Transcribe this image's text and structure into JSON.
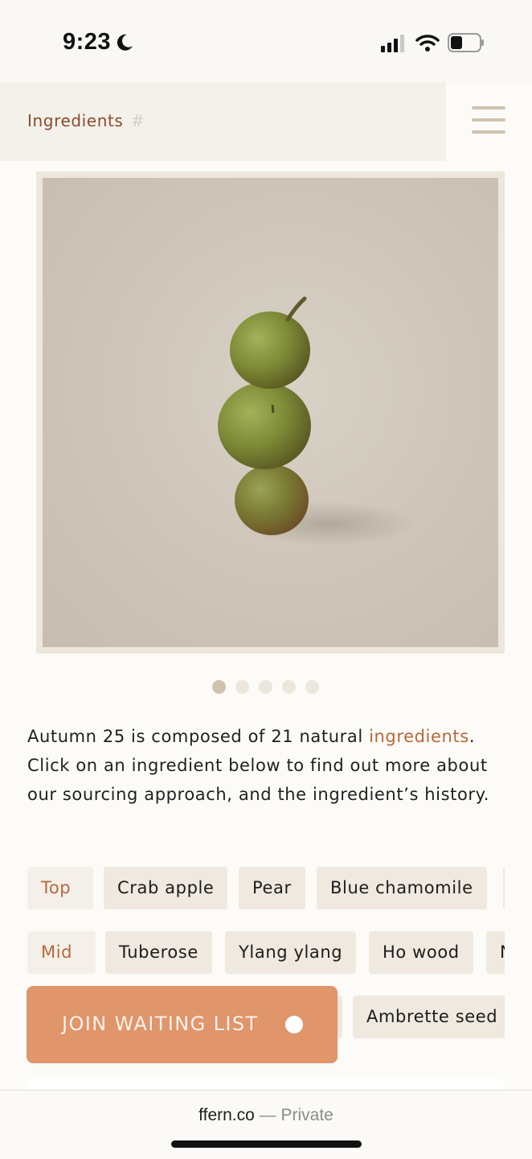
{
  "status_bar": {
    "time": "9:23",
    "icons": [
      "moon-icon",
      "signal-icon",
      "wifi-icon",
      "battery-icon"
    ]
  },
  "header": {
    "title": "Ingredients",
    "hash": "#",
    "menu_icon": "hamburger-menu-icon"
  },
  "hero": {
    "image_alt": "three green apples stacked",
    "carousel_dots": 5,
    "active_dot": 1
  },
  "description": {
    "before_link": "Autumn 25 is composed of 21 natural ",
    "link": "ingredients",
    "after_link": ". Click on an ingredient below to find out more about our sourcing approach, and the ingredient’s history."
  },
  "ingredients": {
    "top": {
      "label": "Top",
      "items": [
        "Crab apple",
        "Pear",
        "Blue chamomile"
      ]
    },
    "mid": {
      "label": "Mid",
      "items": [
        "Tuberose",
        "Ylang ylang",
        "Ho wood",
        "N"
      ]
    },
    "base": {
      "items": [
        "Ambrette seed"
      ]
    }
  },
  "join_button": {
    "label": "JOIN WAITING LIST"
  },
  "footer": {
    "domain": "ffern.co",
    "separator": " — ",
    "mode": "Private"
  },
  "colors": {
    "accent": "#b8683c",
    "button": "#e0956b",
    "chip": "#efe9df",
    "header_bg": "#f4f1ea",
    "page_bg": "#fcfbf8"
  }
}
